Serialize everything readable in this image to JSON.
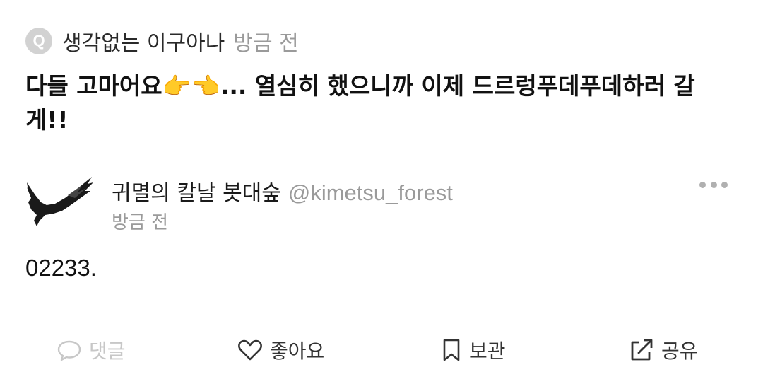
{
  "question": {
    "badge": "Q",
    "asker": "생각없는 이구아나",
    "time": "방금 전",
    "text": "다들 고마어요👉👈... 열심히 했으니까 이제 드르렁푸데푸데하러 갈게!!"
  },
  "answer": {
    "author_name": "귀멸의 칼날 봇대숲",
    "author_handle": "@kimetsu_forest",
    "time": "방금 전",
    "text": "02233."
  },
  "actions": {
    "comment": "댓글",
    "like": "좋아요",
    "save": "보관",
    "share": "공유"
  },
  "icons": {
    "badge": "q-badge-icon",
    "avatar": "crow-avatar",
    "more": "more-dots-icon",
    "comment": "speech-bubble-icon",
    "like": "heart-icon",
    "save": "bookmark-icon",
    "share": "share-arrow-icon"
  },
  "colors": {
    "muted_text": "#9a9a9a",
    "disabled_text": "#c7c7c7",
    "badge_bg": "#d2d2d2"
  }
}
